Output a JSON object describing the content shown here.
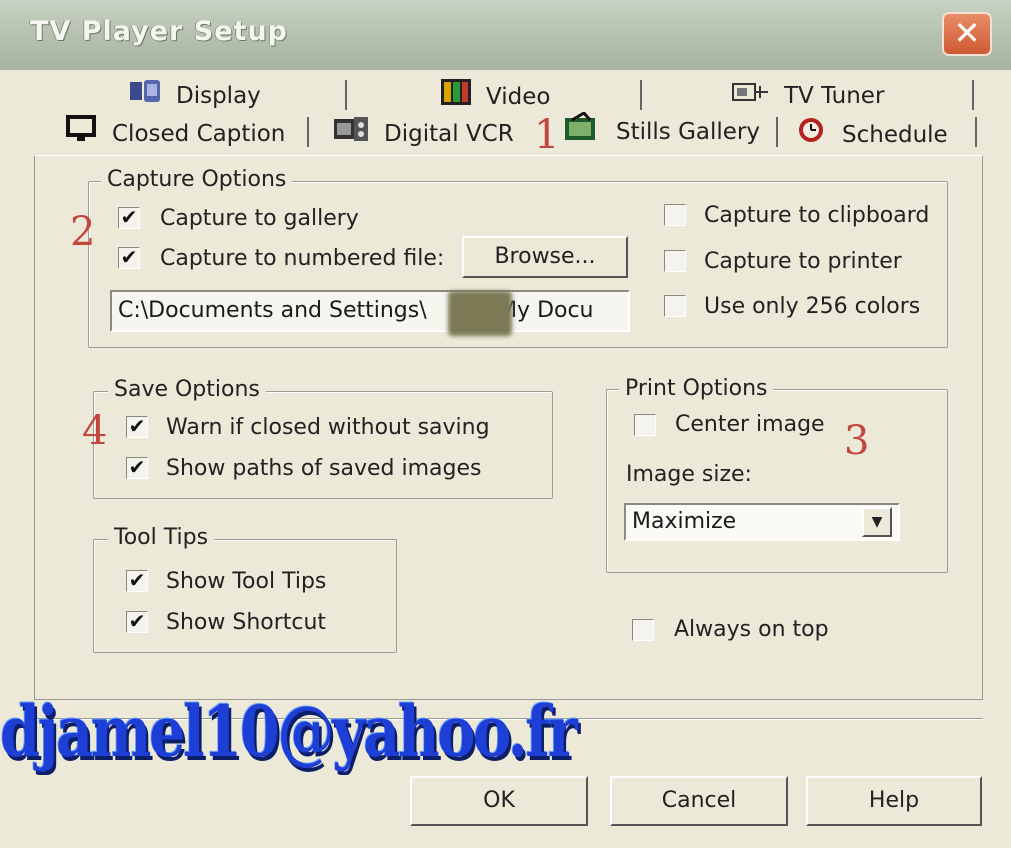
{
  "window": {
    "title": "TV Player Setup"
  },
  "tabs": {
    "row1": [
      {
        "label": "Display",
        "icon": "display-icon"
      },
      {
        "label": "Video",
        "icon": "video-icon"
      },
      {
        "label": "TV Tuner",
        "icon": "tv-tuner-icon"
      }
    ],
    "row2": [
      {
        "label": "Closed Caption",
        "icon": "closed-caption-icon"
      },
      {
        "label": "Digital VCR",
        "icon": "digital-vcr-icon"
      },
      {
        "label": "Stills Gallery",
        "icon": "stills-gallery-icon",
        "selected": true
      },
      {
        "label": "Schedule",
        "icon": "schedule-icon"
      }
    ]
  },
  "annotations": {
    "one": "1",
    "two": "2",
    "three": "3",
    "four": "4"
  },
  "capture_options": {
    "legend": "Capture Options",
    "capture_to_gallery": {
      "label": "Capture to gallery",
      "checked": true
    },
    "capture_to_numbered_file": {
      "label": "Capture to numbered file:",
      "checked": true
    },
    "browse_label": "Browse...",
    "path_value": "C:\\Documents and Settings\\",
    "path_value_tail": "\\My Docu",
    "capture_to_clipboard": {
      "label": "Capture to clipboard",
      "checked": false
    },
    "capture_to_printer": {
      "label": "Capture to printer",
      "checked": false
    },
    "use_256_colors": {
      "label": "Use only 256 colors",
      "checked": false
    }
  },
  "save_options": {
    "legend": "Save Options",
    "warn_closed": {
      "label": "Warn if closed without saving",
      "checked": true
    },
    "show_paths": {
      "label": "Show paths of saved images",
      "checked": true
    }
  },
  "print_options": {
    "legend": "Print Options",
    "center_image": {
      "label": "Center image",
      "checked": false
    },
    "image_size_label": "Image size:",
    "image_size_value": "Maximize"
  },
  "tool_tips": {
    "legend": "Tool Tips",
    "show_tool_tips": {
      "label": "Show Tool Tips",
      "checked": true
    },
    "show_shortcut": {
      "label": "Show Shortcut",
      "checked": true
    }
  },
  "always_on_top": {
    "label": "Always on top",
    "checked": false
  },
  "buttons": {
    "ok": "OK",
    "cancel": "Cancel",
    "help": "Help"
  },
  "watermark": "djamel10@yahoo.fr",
  "check_mark": "✔",
  "close_glyph": "✕",
  "dropdown_glyph": "▼"
}
